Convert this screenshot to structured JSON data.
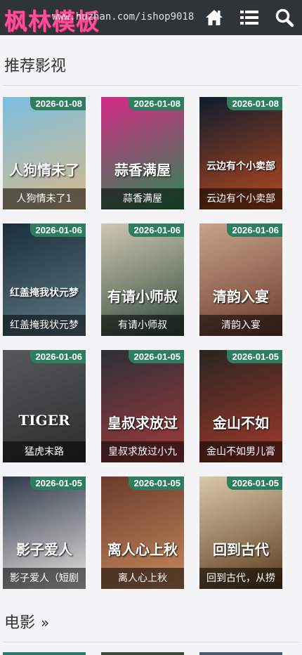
{
  "header": {
    "logo": "枫林模板",
    "watermark": "www.huzhan.com/ishop9018"
  },
  "sections": {
    "recommended": {
      "title": "推荐影视"
    },
    "movies": {
      "title": "电影",
      "more": "»"
    }
  },
  "cards": [
    {
      "date": "2026-01-08",
      "title": "人狗情未了1",
      "poster_text": "人狗情未了",
      "colors": [
        "#7bbfe0",
        "#d9b98a"
      ]
    },
    {
      "date": "2026-01-08",
      "title": "蒜香满屋",
      "poster_text": "蒜香满屋",
      "colors": [
        "#d42a86",
        "#2a8a52"
      ]
    },
    {
      "date": "2026-01-08",
      "title": "云边有个小卖部",
      "poster_text": "云边有个小卖部",
      "colors": [
        "#0e1c2e",
        "#b84a1c"
      ]
    },
    {
      "date": "2026-01-06",
      "title": "红盖掩我状元梦",
      "poster_text": "红盖掩我状元梦",
      "colors": [
        "#1b2e3c",
        "#5f7a85"
      ]
    },
    {
      "date": "2026-01-06",
      "title": "有请小师叔",
      "poster_text": "有请小师叔",
      "colors": [
        "#cfc7b2",
        "#2f4b3a"
      ]
    },
    {
      "date": "2026-01-06",
      "title": "清韵入宴",
      "poster_text": "清韵入宴",
      "colors": [
        "#c7a48a",
        "#6b3a2c"
      ]
    },
    {
      "date": "2026-01-06",
      "title": "猛虎末路",
      "poster_text": "TIGER",
      "colors": [
        "#55595a",
        "#2b2d2c"
      ]
    },
    {
      "date": "2026-01-05",
      "title": "皇叔求放过小九",
      "poster_text": "皇叔求放过",
      "colors": [
        "#2c3038",
        "#a23a3a"
      ]
    },
    {
      "date": "2026-01-05",
      "title": "金山不如男儿膏",
      "poster_text": "金山不如",
      "colors": [
        "#2a2520",
        "#a23a2c"
      ]
    },
    {
      "date": "2026-01-05",
      "title": "影子爱人（短剧",
      "poster_text": "影子爱人",
      "colors": [
        "#2e3a4a",
        "#e8e2df"
      ]
    },
    {
      "date": "2026-01-05",
      "title": "离人心上秋",
      "poster_text": "离人心上秋",
      "colors": [
        "#6a3a2c",
        "#c78a5c"
      ]
    },
    {
      "date": "2026-01-05",
      "title": "回到古代，从捞",
      "poster_text": "回到古代",
      "colors": [
        "#d8c9a8",
        "#5a3a1c"
      ]
    }
  ],
  "next_row_colors": [
    "#2c7a6a",
    "#3c4a3a",
    "#4a5a6a"
  ],
  "icons": [
    "home-icon",
    "list-icon",
    "search-icon"
  ]
}
